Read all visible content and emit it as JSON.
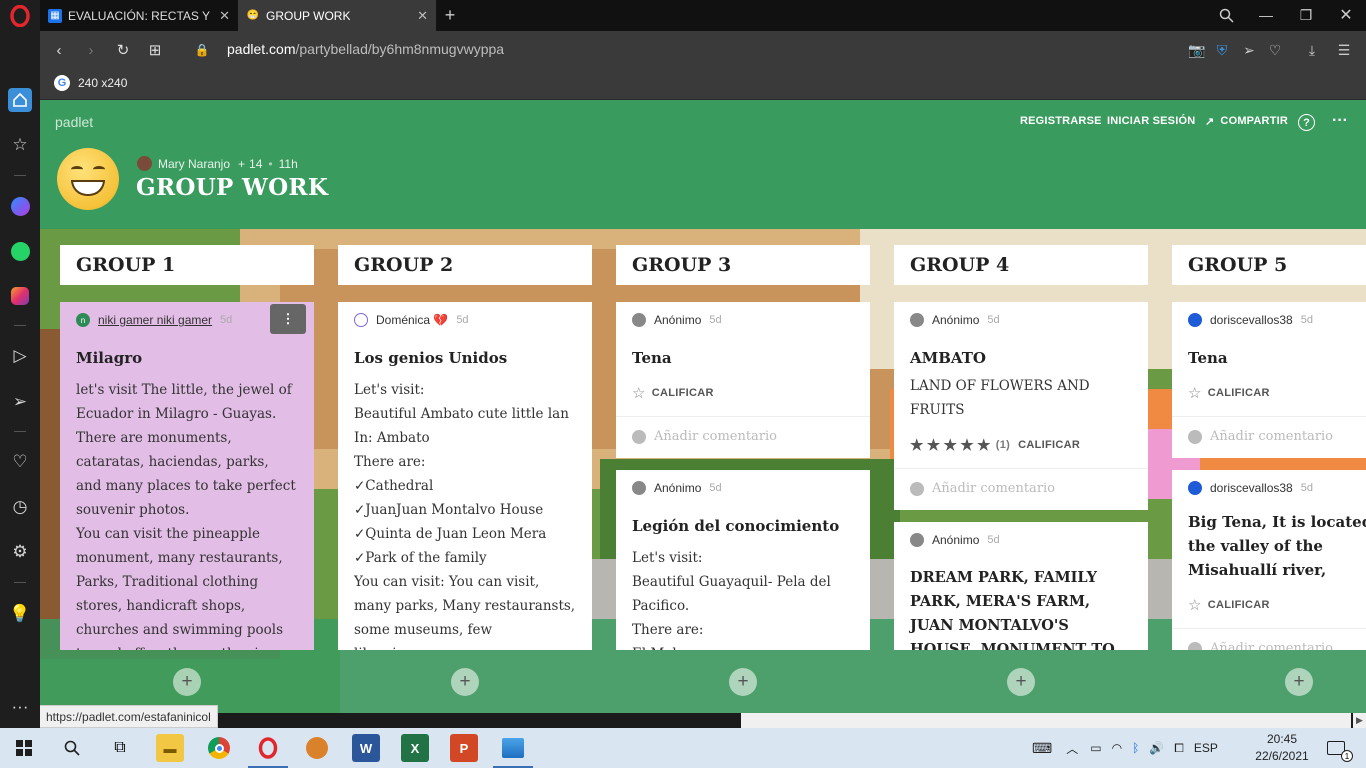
{
  "browser": {
    "tabs": [
      {
        "title": "EVALUACIÓN: RECTAS Y PU",
        "active": false
      },
      {
        "title": "GROUP WORK",
        "active": true
      }
    ],
    "url_host": "padlet.com",
    "url_path": "/partybellad/by6hm8nmugvwyppa",
    "bookmark": "240 x240",
    "hover_url": "https://padlet.com/estafaninicol"
  },
  "padlet": {
    "brand": "padlet",
    "register": "REGISTRARSE",
    "login": "INICIAR SESIÓN",
    "share": "COMPARTIR",
    "author": "Mary Naranjo",
    "contributors": "14",
    "age": "11h",
    "title": "GROUP WORK"
  },
  "columns": [
    {
      "title": "GROUP 1",
      "cards": [
        {
          "author": "niki gamer niki gamer",
          "time": "5d",
          "title": "Milagro",
          "body": "let's visit The little, the jewel of Ecuador in Milagro - Guayas. There are  monuments, cataratas, haciendas, parks, and many places to take perfect souvenir photos.\nYou can visit the pineapple monument, many restaurants, Parks, Traditional clothing stores, handicraft shops, churches and swimming pools to cool off as the weather is warm."
        }
      ]
    },
    {
      "title": "GROUP 2",
      "cards": [
        {
          "author": "Doménica 💔",
          "time": "5d",
          "title": "Los genios Unidos",
          "body": "Let's visit:\nBeautiful Ambato cute  little lan\nIn: Ambato\nThere are:\n✓Cathedral\n✓JuanJuan Montalvo House\n✓Quinta de Juan Leon Mera\n✓Park of  the family\nYou can visit: You can visit, many parks, Many restauransts, some museums, few\nlibraries"
        }
      ]
    },
    {
      "title": "GROUP 3",
      "cards": [
        {
          "author": "Anónimo",
          "time": "5d",
          "title": "Tena",
          "action": "CALIFICAR",
          "comment": "Añadir comentario"
        },
        {
          "author": "Anónimo",
          "time": "5d",
          "title": "Legión del conocimiento",
          "body": "Let's visit:\nBeautiful Guayaquil- Pela del Pacifico.\nThere are:\nEl Malecon"
        }
      ]
    },
    {
      "title": "GROUP 4",
      "cards": [
        {
          "author": "Anónimo",
          "time": "5d",
          "title": "AMBATO",
          "body": "LAND OF FLOWERS AND FRUITS",
          "rating": 5,
          "rating_count": "(1)",
          "action": "CALIFICAR",
          "comment": "Añadir comentario"
        },
        {
          "author": "Anónimo",
          "time": "5d",
          "title": "DREAM PARK, FAMILY PARK, MERA'S FARM, JUAN MONTALVO'S HOUSE, MONUMENT TO THE CONSTITUENT SECOND"
        }
      ]
    },
    {
      "title": "GROUP 5",
      "cards": [
        {
          "author": "doriscevallos38",
          "time": "5d",
          "title": "Tena",
          "action": "CALIFICAR",
          "comment": "Añadir comentario"
        },
        {
          "author": "doriscevallos38",
          "time": "5d",
          "title": "Big Tena, It is located on the valley of the Misahuallí river,",
          "action": "CALIFICAR",
          "comment": "Añadir comentario"
        }
      ]
    }
  ],
  "taskbar": {
    "lang": "ESP",
    "time": "20:45",
    "date": "22/6/2021",
    "notifications": "1"
  },
  "colors": {
    "padlet_green": "#3a9b5f",
    "card_pink": "#e2bde6",
    "opera_red": "#e2262d"
  }
}
